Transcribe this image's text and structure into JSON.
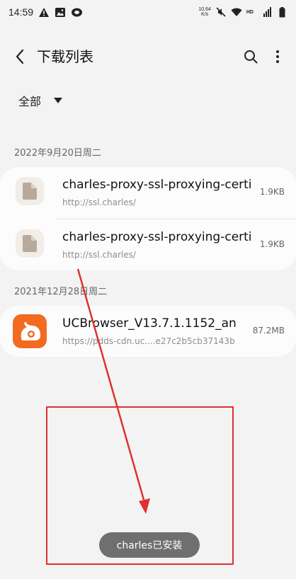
{
  "status_bar": {
    "time": "14:59",
    "net_speed_value": "10.64",
    "net_speed_unit": "K/s",
    "hd_label": "HD",
    "signal_label": "4G",
    "icons": [
      "warning-icon",
      "image-icon",
      "app-notification-icon",
      "mute-icon",
      "wifi-icon",
      "signal-icon",
      "battery-icon"
    ]
  },
  "app_bar": {
    "title": "下载列表",
    "back_icon": "back-arrow-icon",
    "search_icon": "search-icon",
    "more_icon": "more-vert-icon"
  },
  "filter": {
    "selected": "全部"
  },
  "groups": [
    {
      "date": "2022年9月20日周二",
      "items": [
        {
          "icon": "file-icon",
          "title": "charles-proxy-ssl-proxying-certi",
          "url": "http://ssl.charles/",
          "size": "1.9KB"
        },
        {
          "icon": "file-icon",
          "title": "charles-proxy-ssl-proxying-certi",
          "url": "http://ssl.charles/",
          "size": "1.9KB"
        }
      ]
    },
    {
      "date": "2021年12月28日周二",
      "items": [
        {
          "icon": "uc-browser-icon",
          "title": "UCBrowser_V13.7.1.1152_an",
          "url": "https://pdds-cdn.uc....e27c2b5cb37143b",
          "size": "87.2MB"
        }
      ]
    }
  ],
  "toast": {
    "text": "charles已安装"
  },
  "annotation": {
    "box_color": "#e03030",
    "arrow_color": "#e03030"
  },
  "colors": {
    "background": "#f3f3f3",
    "card": "#fcfcfc",
    "uc_orange": "#f26b21",
    "toast_bg": "#6f6f6f"
  }
}
